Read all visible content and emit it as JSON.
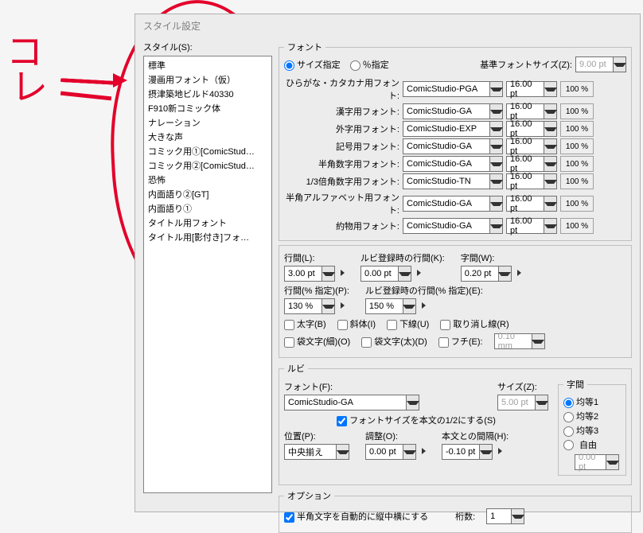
{
  "window_title": "スタイル設定",
  "style_label": "スタイル(S):",
  "styles": [
    "標準",
    "漫画用フォント（仮）",
    "摂津築地ビルド40330",
    "F910新コミック体",
    "ナレーション",
    "大きな声",
    "コミック用①[ComicStud…",
    "コミック用②[ComicStud…",
    "恐怖",
    "内面語り②[GT]",
    "内面語り①",
    "タイトル用フォント",
    "タイトル用[影付き]フォ…"
  ],
  "font_group": "フォント",
  "size_mode": {
    "size_label": "サイズ指定",
    "pct_label": "％指定"
  },
  "base_font_label": "基準フォントサイズ(Z):",
  "base_font_value": "9.00 pt",
  "font_rows": [
    {
      "label": "ひらがな・カタカナ用フォント:",
      "font": "ComicStudio-PGA",
      "size": "16.00 pt",
      "pct": "100 %"
    },
    {
      "label": "漢字用フォント:",
      "font": "ComicStudio-GA",
      "size": "16.00 pt",
      "pct": "100 %"
    },
    {
      "label": "外字用フォント:",
      "font": "ComicStudio-EXP",
      "size": "16.00 pt",
      "pct": "100 %"
    },
    {
      "label": "記号用フォント:",
      "font": "ComicStudio-GA",
      "size": "16.00 pt",
      "pct": "100 %"
    },
    {
      "label": "半角数字用フォント:",
      "font": "ComicStudio-GA",
      "size": "16.00 pt",
      "pct": "100 %"
    },
    {
      "label": "1/3倍角数字用フォント:",
      "font": "ComicStudio-TN",
      "size": "16.00 pt",
      "pct": "100 %"
    },
    {
      "label": "半角アルファベット用フォント:",
      "font": "ComicStudio-GA",
      "size": "16.00 pt",
      "pct": "100 %"
    },
    {
      "label": "約物用フォント:",
      "font": "ComicStudio-GA",
      "size": "16.00 pt",
      "pct": "100 %"
    }
  ],
  "spacing": {
    "line_l": "行間(L):",
    "line_val": "3.00 pt",
    "ruby_l": "ルビ登録時の行間(K):",
    "ruby_val": "0.00 pt",
    "char_l": "字間(W):",
    "char_val": "0.20 pt",
    "linep_l": "行間(% 指定)(P):",
    "linep_val": "130 %",
    "rubyp_l": "ルビ登録時の行間(% 指定)(E):",
    "rubyp_val": "150 %",
    "bold": "太字(B)",
    "italic": "斜体(I)",
    "under": "下線(U)",
    "strike": "取り消し線(R)",
    "bag_thin": "袋文字(細)(O)",
    "bag_thick": "袋文字(太)(D)",
    "edge": "フチ(E):",
    "edge_val": "0.10 mm"
  },
  "ruby": {
    "title": "ルビ",
    "font_l": "フォント(F):",
    "font_v": "ComicStudio-GA",
    "size_l": "サイズ(Z):",
    "size_v": "5.00 pt",
    "half_chk": "フォントサイズを本文の1/2にする(S)",
    "pos_l": "位置(P):",
    "pos_v": "中央揃え",
    "adj_l": "調整(O):",
    "adj_v": "0.00 pt",
    "gap_l": "本文との間隔(H):",
    "gap_v": "-0.10 pt",
    "jikan": "字間",
    "k1": "均等1",
    "k2": "均等2",
    "k3": "均等3",
    "free": "自由",
    "free_v": "0.00 pt"
  },
  "option": {
    "title": "オプション",
    "auto": "半角文字を自動的に縦中横にする",
    "digits_l": "桁数:",
    "digits_v": "1"
  },
  "annot_text": "コレ"
}
